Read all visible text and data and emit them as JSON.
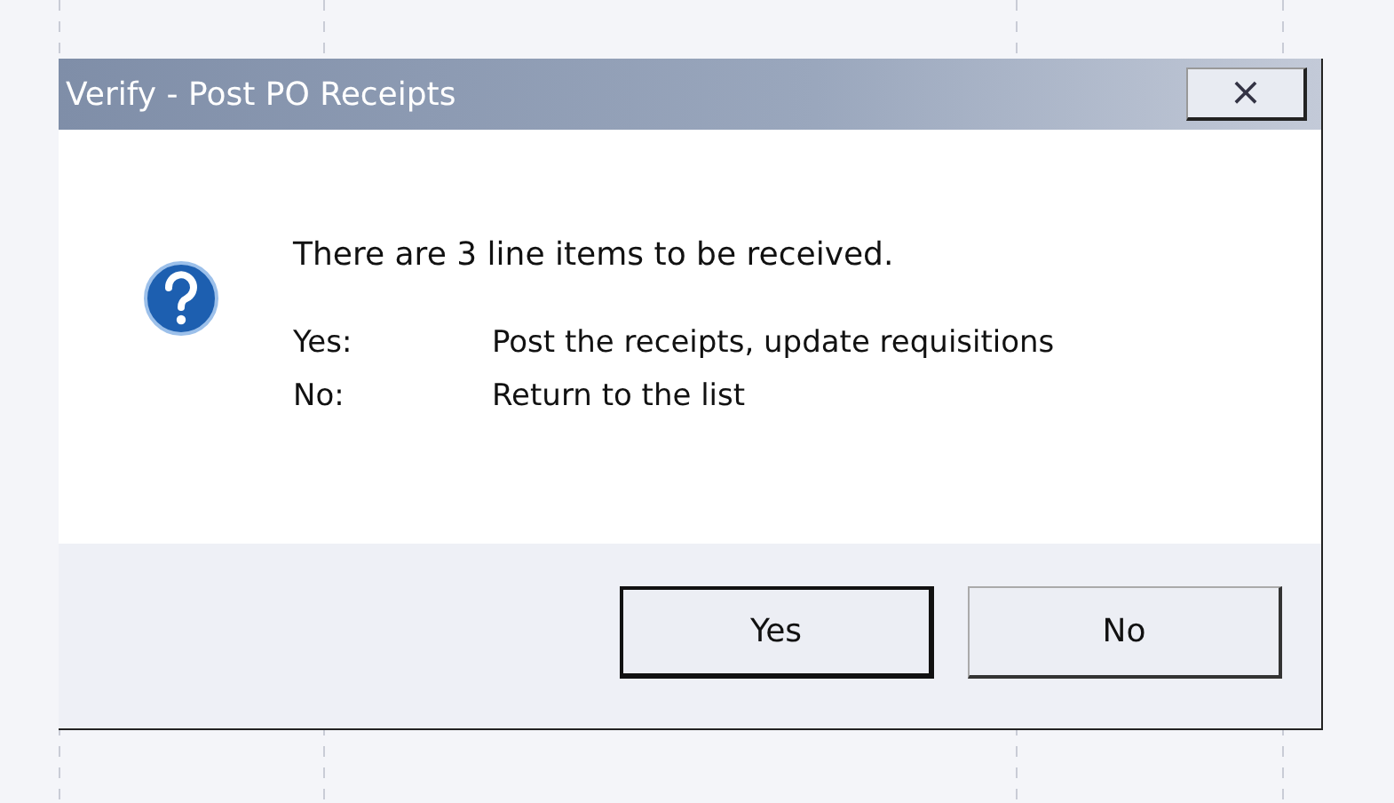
{
  "window": {
    "title": "Verify - Post PO Receipts",
    "close_label": "×"
  },
  "message": "There are 3 line items to be received.",
  "options": [
    {
      "label": "Yes:",
      "text": "Post the receipts, update requisitions"
    },
    {
      "label": "No:",
      "text": "Return to the list"
    }
  ],
  "buttons": [
    {
      "label": "Yes",
      "default": true
    },
    {
      "label": "No",
      "default": false
    }
  ]
}
